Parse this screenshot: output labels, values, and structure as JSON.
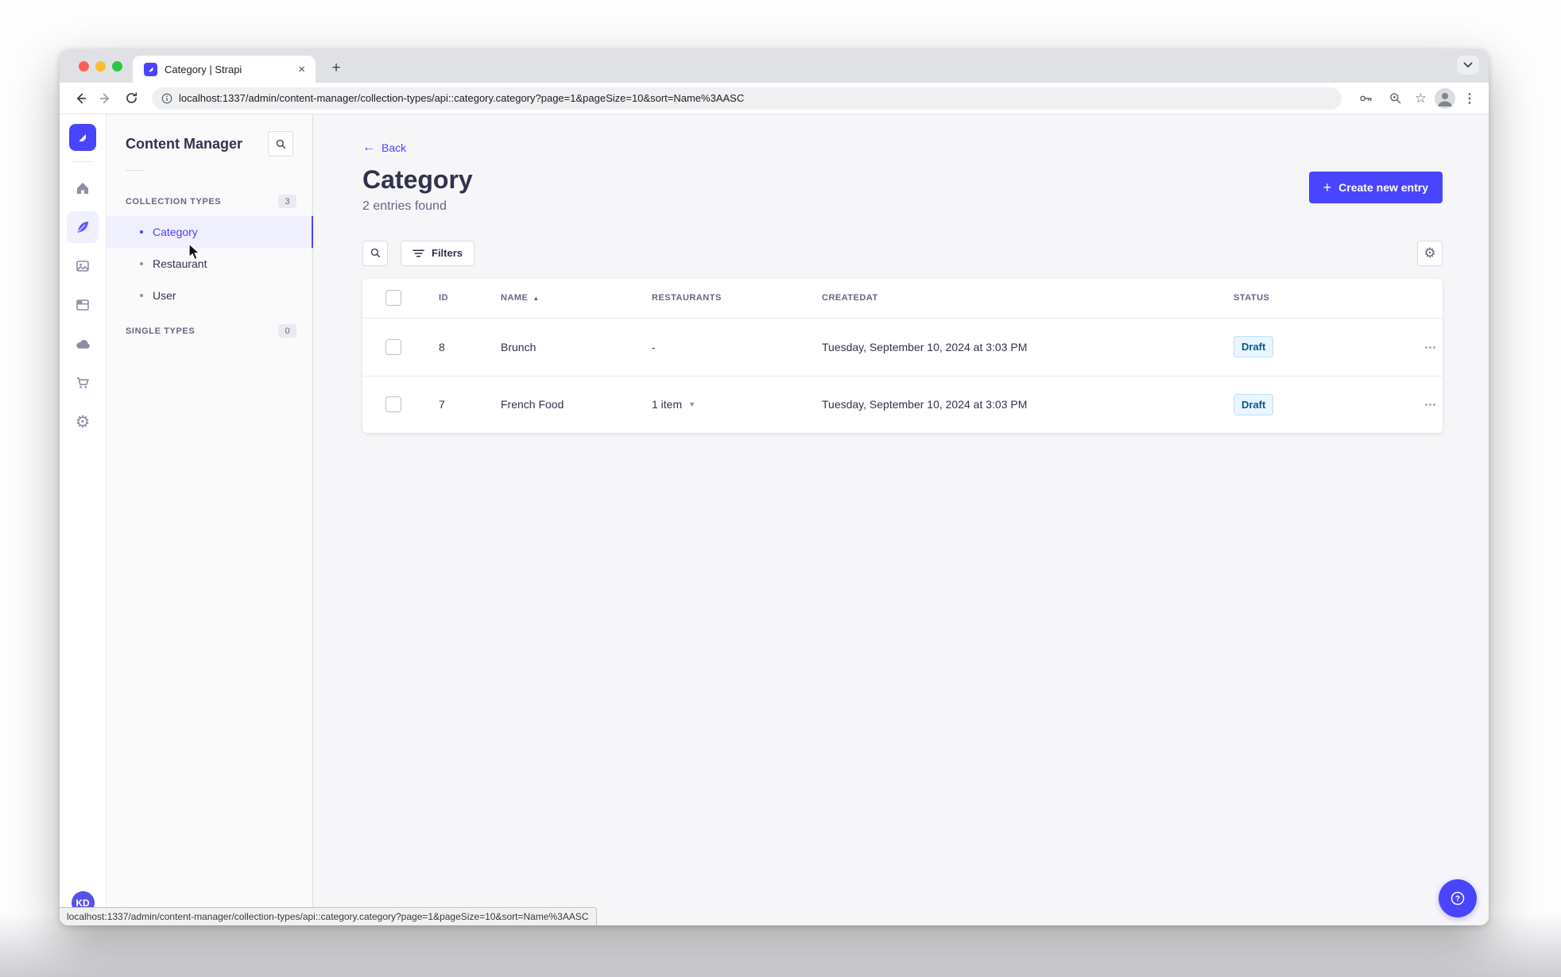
{
  "browser": {
    "tab_title": "Category | Strapi",
    "new_tab_label": "+",
    "close_tab_label": "×",
    "url": "localhost:1337/admin/content-manager/collection-types/api::category.category?page=1&pageSize=10&sort=Name%3AASC",
    "status_url": "localhost:1337/admin/content-manager/collection-types/api::category.category?page=1&pageSize=10&sort=Name%3AASC"
  },
  "app": {
    "nav_rail": {
      "avatar_initials": "KD"
    },
    "subnav": {
      "title": "Content Manager",
      "collection_types": {
        "label": "COLLECTION TYPES",
        "count": "3",
        "items": [
          {
            "label": "Category",
            "active": true
          },
          {
            "label": "Restaurant",
            "active": false
          },
          {
            "label": "User",
            "active": false
          }
        ]
      },
      "single_types": {
        "label": "SINGLE TYPES",
        "count": "0"
      }
    },
    "header": {
      "back_label": "Back",
      "title": "Category",
      "subtitle": "2 entries found",
      "create_button_label": "Create new entry"
    },
    "toolbar": {
      "filters_label": "Filters"
    },
    "table": {
      "columns": [
        "ID",
        "NAME",
        "RESTAURANTS",
        "CREATEDAT",
        "STATUS"
      ],
      "sorted_column": "NAME",
      "sort_direction": "ASC",
      "rows": [
        {
          "id": "8",
          "name": "Brunch",
          "restaurants": "-",
          "created_at": "Tuesday, September 10, 2024 at 3:03 PM",
          "status": "Draft"
        },
        {
          "id": "7",
          "name": "French Food",
          "restaurants": "1 item",
          "created_at": "Tuesday, September 10, 2024 at 3:03 PM",
          "status": "Draft"
        }
      ]
    },
    "colors": {
      "primary": "#4945ff",
      "active_item_bg": "#f0f0ff",
      "draft_badge_bg": "#eaf5ff",
      "draft_badge_border": "#b8e1ff",
      "draft_badge_text": "#006096",
      "content_bg": "#f6f6f9"
    }
  }
}
